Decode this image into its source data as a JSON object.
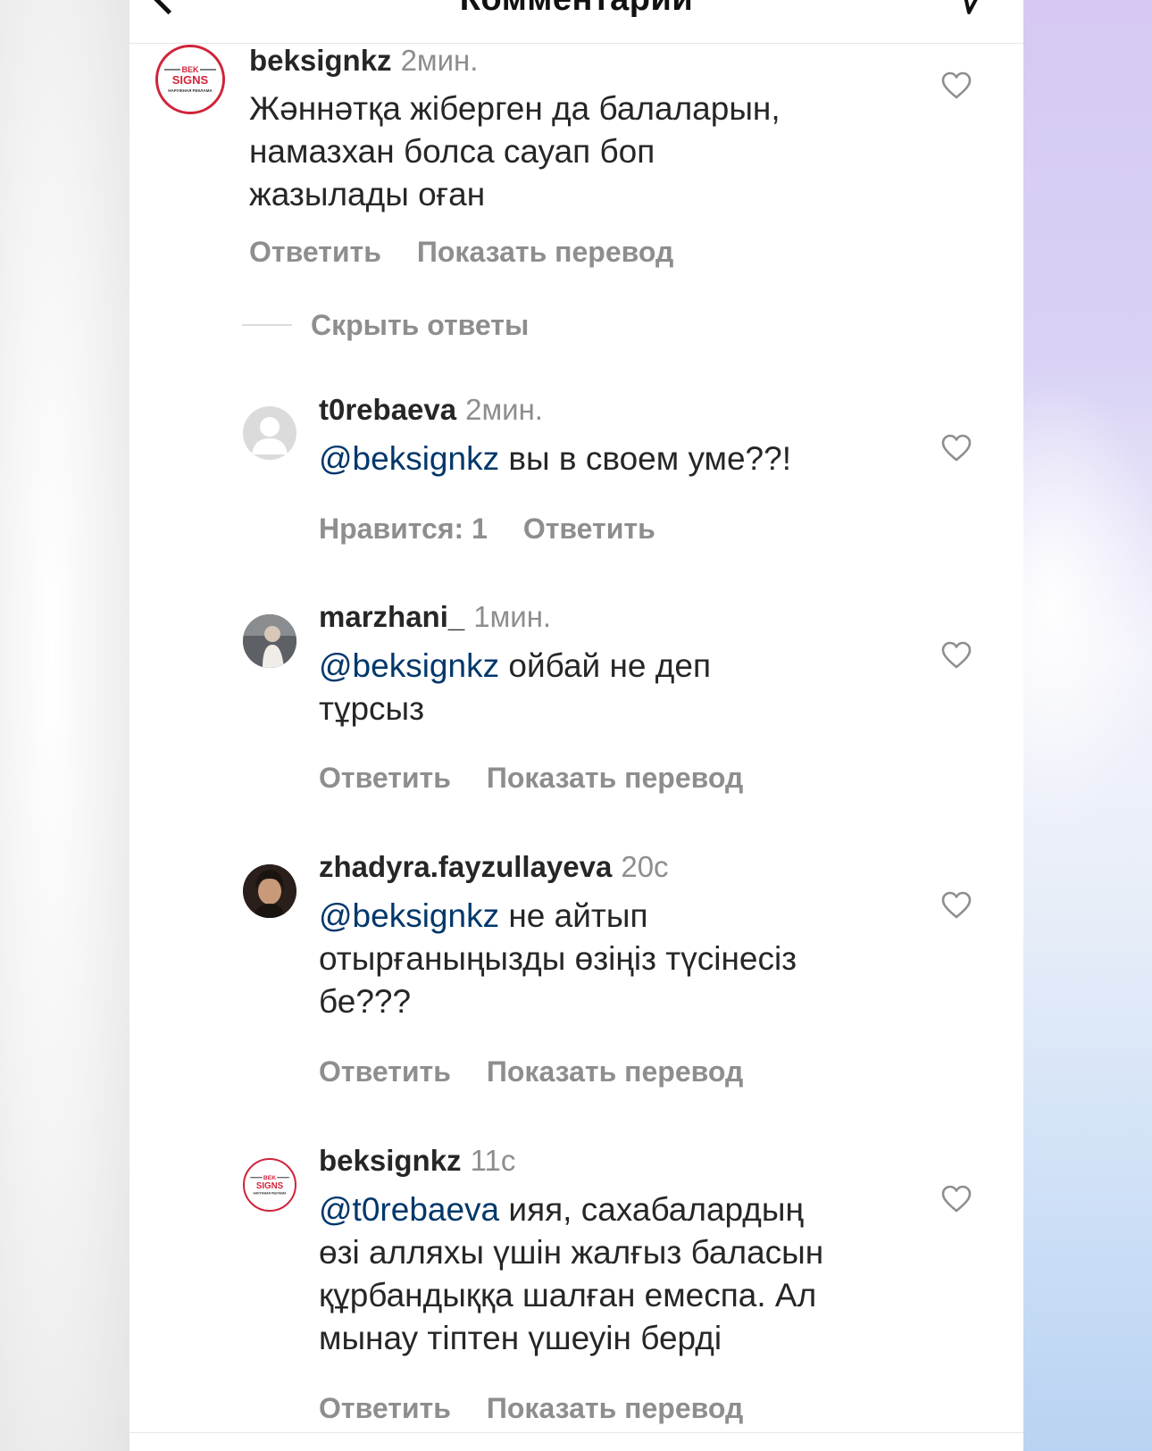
{
  "header": {
    "title": "Комментарии"
  },
  "comments": [
    {
      "username": "beksignkz",
      "time": "2мин.",
      "text_lines": [
        "Жәннәтқа жіберген да балаларын,",
        "намазхан болса сауап боп",
        "жазылады оған"
      ],
      "actions": [
        "Ответить",
        "Показать перевод"
      ]
    }
  ],
  "hide_replies": "Скрыть ответы",
  "replies": [
    {
      "username": "t0rebaeva",
      "time": "2мин.",
      "mention": "@beksignkz",
      "text_lines": [
        " вы в своем уме??!"
      ],
      "actions": [
        "Нравится: 1",
        "Ответить"
      ]
    },
    {
      "username": "marzhani_",
      "time": "1мин.",
      "mention": "@beksignkz",
      "text_lines": [
        " ойбай не деп",
        "тұрсыз"
      ],
      "actions": [
        "Ответить",
        "Показать перевод"
      ]
    },
    {
      "username": "zhadyra.fayzullayeva",
      "time": "20с",
      "mention": "@beksignkz",
      "text_lines": [
        " не айтып",
        "отырғаныңызды өзіңіз түсінесіз",
        "бе???"
      ],
      "actions": [
        "Ответить",
        "Показать перевод"
      ]
    },
    {
      "username": "beksignkz",
      "time": "11с",
      "mention": "@t0rebaeva",
      "text_lines": [
        " ияя, сахабалардың",
        "өзі алляхы үшін жалғыз баласын",
        "құрбандыққа шалған емеспа. Ал",
        "мынау тіптен үшеуін берді"
      ],
      "actions": [
        "Ответить",
        "Показать перевод"
      ]
    }
  ],
  "logo": {
    "top": "BEK",
    "main": "SIGNS",
    "sub": "НАРУЖНАЯ РЕКЛАМА",
    "color": "#d0243a"
  },
  "colors": {
    "mention": "#00376b",
    "secondary": "#8e8e8e",
    "text": "#262626"
  }
}
